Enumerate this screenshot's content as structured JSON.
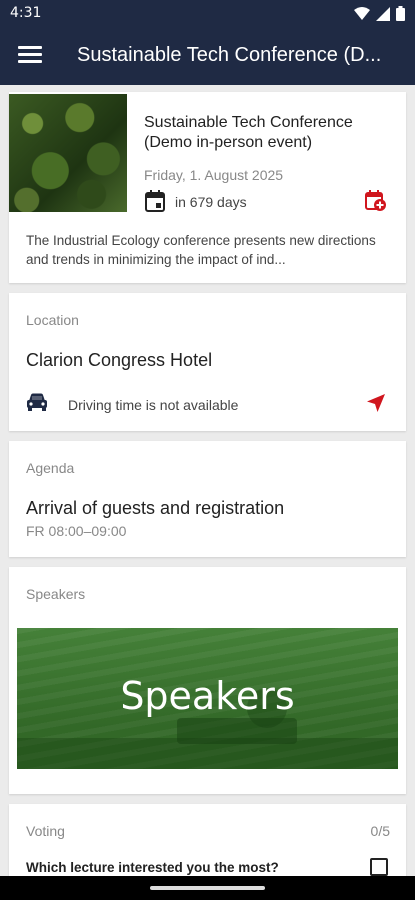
{
  "status": {
    "time": "4:31"
  },
  "appbar": {
    "title": "Sustainable Tech Conference (D..."
  },
  "event": {
    "title": "Sustainable Tech Conference (Demo in-person event)",
    "date": "Friday, 1. August 2025",
    "countdown": "in 679 days",
    "description": "The Industrial Ecology conference presents new directions and trends in minimizing the impact of ind..."
  },
  "location": {
    "label": "Location",
    "name": "Clarion Congress Hotel",
    "driving": "Driving time is not available"
  },
  "agenda": {
    "label": "Agenda",
    "item": "Arrival of guests and registration",
    "time": "FR 08:00–09:00"
  },
  "speakers": {
    "label": "Speakers",
    "banner_text": "Speakers"
  },
  "voting": {
    "label": "Voting",
    "count": "0/5",
    "question": "Which lecture interested you the most?"
  },
  "colors": {
    "appbar": "#1f2a44",
    "accent_red": "#d0161e",
    "banner_green": "#3b7a2e"
  },
  "icons": [
    "menu-icon",
    "calendar-icon",
    "add-calendar-icon",
    "car-icon",
    "navigation-icon",
    "wifi-icon",
    "signal-icon",
    "battery-icon"
  ]
}
